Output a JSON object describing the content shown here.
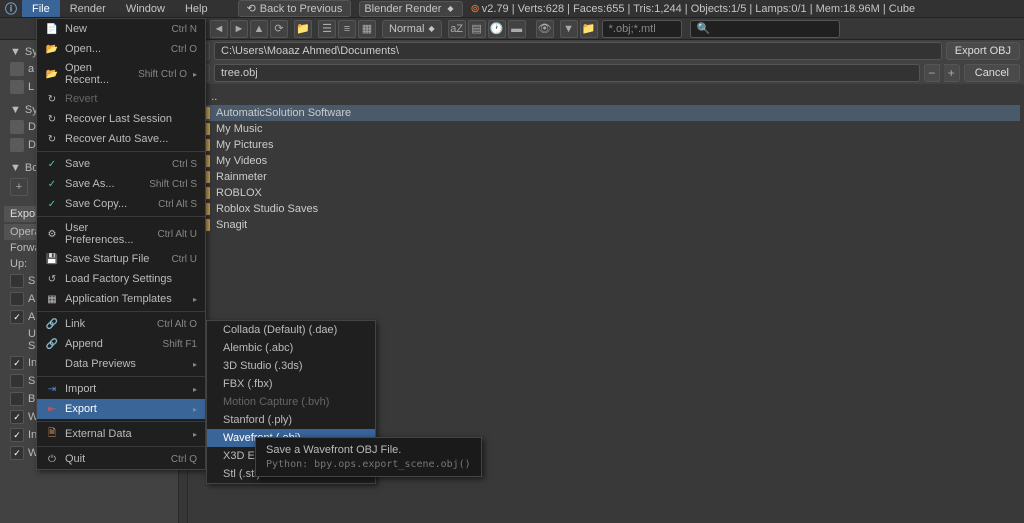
{
  "topbar": {
    "menus": [
      "File",
      "Render",
      "Window",
      "Help"
    ],
    "active_menu_index": 0,
    "back_label": "Back to Previous",
    "engine": "Blender Render",
    "stats": "v2.79 | Verts:628 | Faces:655 | Tris:1,244 | Objects:1/5 | Lamps:0/1 | Mem:18.96M | Cube"
  },
  "toolbar": {
    "shading": "Normal",
    "filter": "*.obj;*.mtl"
  },
  "file_menu": {
    "items": [
      {
        "icon": "📄",
        "label": "New",
        "shortcut": "Ctrl N",
        "cls": ""
      },
      {
        "icon": "📂",
        "label": "Open...",
        "shortcut": "Ctrl O",
        "cls": ""
      },
      {
        "icon": "📂",
        "label": "Open Recent...",
        "shortcut": "Shift Ctrl O",
        "arrow": true,
        "cls": ""
      },
      {
        "icon": "↻",
        "label": "Revert",
        "shortcut": "",
        "cls": "",
        "disabled": true
      },
      {
        "icon": "↻",
        "label": "Recover Last Session",
        "shortcut": "",
        "cls": ""
      },
      {
        "icon": "↻",
        "label": "Recover Auto Save...",
        "shortcut": "",
        "cls": ""
      },
      {
        "sep": true
      },
      {
        "icon": "✓",
        "label": "Save",
        "shortcut": "Ctrl S",
        "cls": "icon-green"
      },
      {
        "icon": "✓",
        "label": "Save As...",
        "shortcut": "Shift Ctrl S",
        "cls": "icon-green"
      },
      {
        "icon": "✓",
        "label": "Save Copy...",
        "shortcut": "Ctrl Alt S",
        "cls": "icon-green"
      },
      {
        "sep": true
      },
      {
        "icon": "⚙",
        "label": "User Preferences...",
        "shortcut": "Ctrl Alt U",
        "cls": ""
      },
      {
        "icon": "💾",
        "label": "Save Startup File",
        "shortcut": "Ctrl U",
        "cls": ""
      },
      {
        "icon": "↺",
        "label": "Load Factory Settings",
        "shortcut": "",
        "cls": ""
      },
      {
        "icon": "▦",
        "label": "Application Templates",
        "shortcut": "",
        "arrow": true,
        "cls": ""
      },
      {
        "sep": true
      },
      {
        "icon": "🔗",
        "label": "Link",
        "shortcut": "Ctrl Alt O",
        "cls": ""
      },
      {
        "icon": "🔗",
        "label": "Append",
        "shortcut": "Shift F1",
        "cls": ""
      },
      {
        "icon": "",
        "label": "Data Previews",
        "shortcut": "",
        "arrow": true,
        "cls": ""
      },
      {
        "sep": true
      },
      {
        "icon": "⇥",
        "label": "Import",
        "shortcut": "",
        "arrow": true,
        "cls": "icon-blue"
      },
      {
        "icon": "⇤",
        "label": "Export",
        "shortcut": "",
        "arrow": true,
        "highlight": true,
        "cls": "icon-red"
      },
      {
        "sep": true
      },
      {
        "icon": "🗎",
        "label": "External Data",
        "shortcut": "",
        "arrow": true,
        "cls": "icon-orange"
      },
      {
        "sep": true
      },
      {
        "icon": "⏻",
        "label": "Quit",
        "shortcut": "Ctrl Q",
        "cls": ""
      }
    ]
  },
  "export_menu": {
    "items": [
      {
        "label": "Collada (Default) (.dae)"
      },
      {
        "label": "Alembic (.abc)"
      },
      {
        "label": "3D Studio (.3ds)"
      },
      {
        "label": "FBX (.fbx)"
      },
      {
        "label": "Motion Capture (.bvh)",
        "disabled": true
      },
      {
        "label": "Stanford (.ply)"
      },
      {
        "label": "Wavefront (.obj)",
        "highlight": true
      },
      {
        "label": "X3D Extensible 3D (.x3d)"
      },
      {
        "label": "Stl (.stl)"
      }
    ]
  },
  "tooltip": {
    "title": "Save a Wavefront OBJ File.",
    "sub": "Python: bpy.ops.export_scene.obj()"
  },
  "file_browser": {
    "path": "C:\\Users\\Moaaz Ahmed\\Documents\\",
    "filename": "tree.obj",
    "export_label": "Export OBJ",
    "cancel_label": "Cancel",
    "items": [
      {
        "name": "..",
        "updir": true
      },
      {
        "name": "AutomaticSolution Software",
        "highlight": true
      },
      {
        "name": "My Music"
      },
      {
        "name": "My Pictures"
      },
      {
        "name": "My Videos"
      },
      {
        "name": "Rainmeter"
      },
      {
        "name": "ROBLOX"
      },
      {
        "name": "Roblox Studio Saves"
      },
      {
        "name": "Snagit"
      }
    ]
  },
  "left_panel": {
    "sys_label": "Sys",
    "bookmarks": "Bookmarks",
    "export_header": "Export OBJ",
    "operator": "Operator Presets",
    "forward": "Forward:",
    "up": "Up:",
    "modifiers": "Use Modifiers Render Settings",
    "checks": [
      "Include Edges",
      "Smooth Groups",
      "Bitflag Smooth Groups",
      "Write Normals",
      "Include UVs",
      "Write Materials"
    ]
  }
}
